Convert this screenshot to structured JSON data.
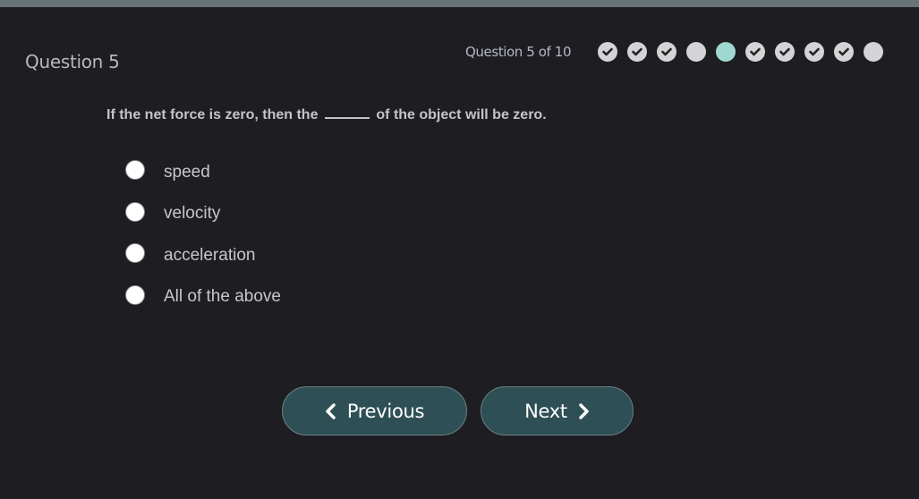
{
  "header": {
    "question_title": "Question 5",
    "progress_label": "Question 5 of 10",
    "progress": {
      "current": 5,
      "total": 10,
      "states": [
        "answered",
        "answered",
        "answered",
        "unanswered",
        "current",
        "answered",
        "answered",
        "answered",
        "answered",
        "unanswered"
      ]
    }
  },
  "question": {
    "text_before": "If the net force is zero, then the",
    "text_after": "of the object will be zero.",
    "options": [
      {
        "label": "speed",
        "selected": false
      },
      {
        "label": "velocity",
        "selected": false
      },
      {
        "label": "acceleration",
        "selected": false
      },
      {
        "label": "All of the above",
        "selected": false
      }
    ]
  },
  "nav": {
    "previous_label": "Previous",
    "next_label": "Next",
    "previous_icon": "chevron-left-icon",
    "next_icon": "chevron-right-icon"
  },
  "colors": {
    "background": "#1e1d21",
    "topbar": "#687378",
    "button_bg": "#2e4f55",
    "current_dot": "#9fd8cf",
    "dot": "#d4d4d6"
  }
}
